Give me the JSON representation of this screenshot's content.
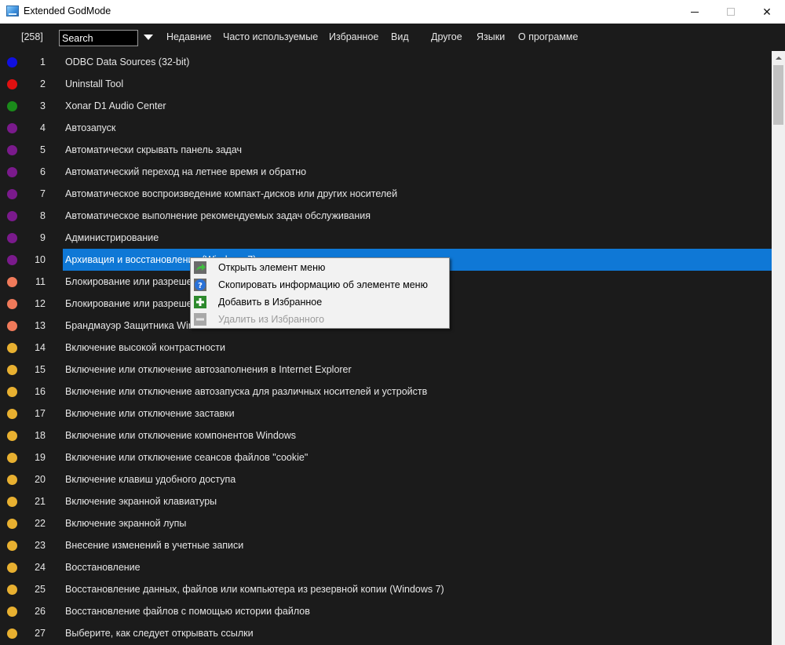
{
  "window": {
    "title": "Extended GodMode",
    "minimize": "",
    "maximize": "",
    "close": "✕"
  },
  "menubar": {
    "count": "[258]",
    "search_placeholder": "Search",
    "items": [
      "Недавние",
      "Часто используемые",
      "Избранное",
      "Вид",
      "Другое",
      "Языки",
      "О программе"
    ]
  },
  "list": {
    "selected_index": 10,
    "items": [
      {
        "num": "1",
        "label": "ODBC Data Sources (32-bit)",
        "color": "#1010e0"
      },
      {
        "num": "2",
        "label": "Uninstall Tool",
        "color": "#e01010"
      },
      {
        "num": "3",
        "label": "Xonar D1 Audio Center",
        "color": "#1a8a1a"
      },
      {
        "num": "4",
        "label": "Автозапуск",
        "color": "#7a1a8c"
      },
      {
        "num": "5",
        "label": "Автоматически скрывать панель задач",
        "color": "#7a1a8c"
      },
      {
        "num": "6",
        "label": "Автоматический переход на летнее время и обратно",
        "color": "#7a1a8c"
      },
      {
        "num": "7",
        "label": "Автоматическое воспроизведение компакт-дисков или других носителей",
        "color": "#7a1a8c"
      },
      {
        "num": "8",
        "label": "Автоматическое выполнение рекомендуемых задач обслуживания",
        "color": "#7a1a8c"
      },
      {
        "num": "9",
        "label": "Администрирование",
        "color": "#7a1a8c"
      },
      {
        "num": "10",
        "label": "Архивация и восстановление (Windows 7)",
        "color": "#7a1a8c"
      },
      {
        "num": "11",
        "label": "Блокирование или разрешение всплывающих окон",
        "color": "#f07a5a"
      },
      {
        "num": "12",
        "label": "Блокирование или разрешение программ через брандмауэр Windows",
        "color": "#f07a5a"
      },
      {
        "num": "13",
        "label": "Брандмауэр Защитника Windows",
        "color": "#f07a5a"
      },
      {
        "num": "14",
        "label": "Включение высокой контрастности",
        "color": "#e8b030"
      },
      {
        "num": "15",
        "label": "Включение или отключение автозаполнения в Internet Explorer",
        "color": "#e8b030"
      },
      {
        "num": "16",
        "label": "Включение или отключение автозапуска для различных носителей и устройств",
        "color": "#e8b030"
      },
      {
        "num": "17",
        "label": "Включение или отключение заставки",
        "color": "#e8b030"
      },
      {
        "num": "18",
        "label": "Включение или отключение компонентов Windows",
        "color": "#e8b030"
      },
      {
        "num": "19",
        "label": "Включение или отключение сеансов файлов \"cookie\"",
        "color": "#e8b030"
      },
      {
        "num": "20",
        "label": "Включение клавиш удобного доступа",
        "color": "#e8b030"
      },
      {
        "num": "21",
        "label": "Включение экранной клавиатуры",
        "color": "#e8b030"
      },
      {
        "num": "22",
        "label": "Включение экранной лупы",
        "color": "#e8b030"
      },
      {
        "num": "23",
        "label": "Внесение изменений в учетные записи",
        "color": "#e8b030"
      },
      {
        "num": "24",
        "label": "Восстановление",
        "color": "#e8b030"
      },
      {
        "num": "25",
        "label": "Восстановление данных, файлов или компьютера из резервной копии (Windows 7)",
        "color": "#e8b030"
      },
      {
        "num": "26",
        "label": "Восстановление файлов с помощью истории файлов",
        "color": "#e8b030"
      },
      {
        "num": "27",
        "label": "Выберите, как следует открывать ссылки",
        "color": "#e8b030"
      }
    ]
  },
  "context_menu": {
    "items": [
      {
        "label": "Открыть элемент меню",
        "icon": "green-arrow-icon",
        "disabled": false
      },
      {
        "label": "Скопировать информацию об элементе меню",
        "icon": "help-icon",
        "disabled": false
      },
      {
        "label": "Добавить в Избранное",
        "icon": "add-icon",
        "disabled": false
      },
      {
        "label": "Удалить из Избранного",
        "icon": "remove-icon",
        "disabled": true
      }
    ]
  }
}
